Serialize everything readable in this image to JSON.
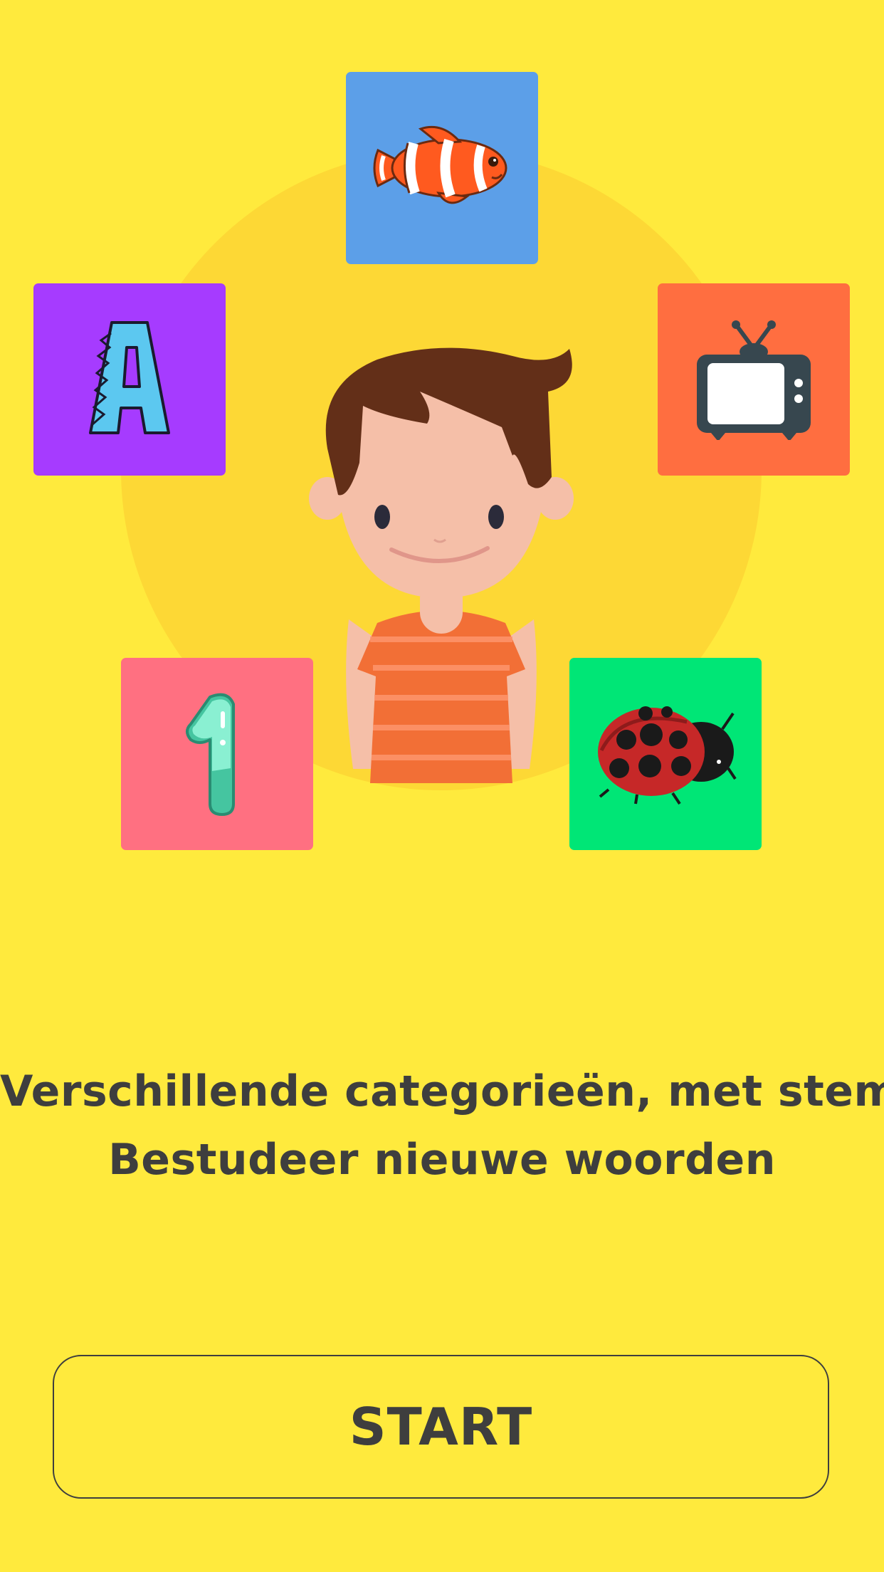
{
  "colors": {
    "background": "#FFEA3D",
    "halo": "#FDD835",
    "text": "#3E3E3E"
  },
  "categories": [
    {
      "id": "animals",
      "icon": "clownfish-icon",
      "color": "#5C9FE8"
    },
    {
      "id": "letters",
      "icon": "letter-a-icon",
      "color": "#A63BFF"
    },
    {
      "id": "objects",
      "icon": "television-icon",
      "color": "#FF6E40"
    },
    {
      "id": "numbers",
      "icon": "number-one-icon",
      "color": "#FF7081"
    },
    {
      "id": "insects",
      "icon": "ladybug-icon",
      "color": "#00E676"
    }
  ],
  "mascot": {
    "icon": "boy-mascot-illustration"
  },
  "tagline": {
    "line1": "Verschillende categorieën, met stem",
    "line2": "Bestudeer nieuwe woorden"
  },
  "start_button": {
    "label": "START"
  }
}
